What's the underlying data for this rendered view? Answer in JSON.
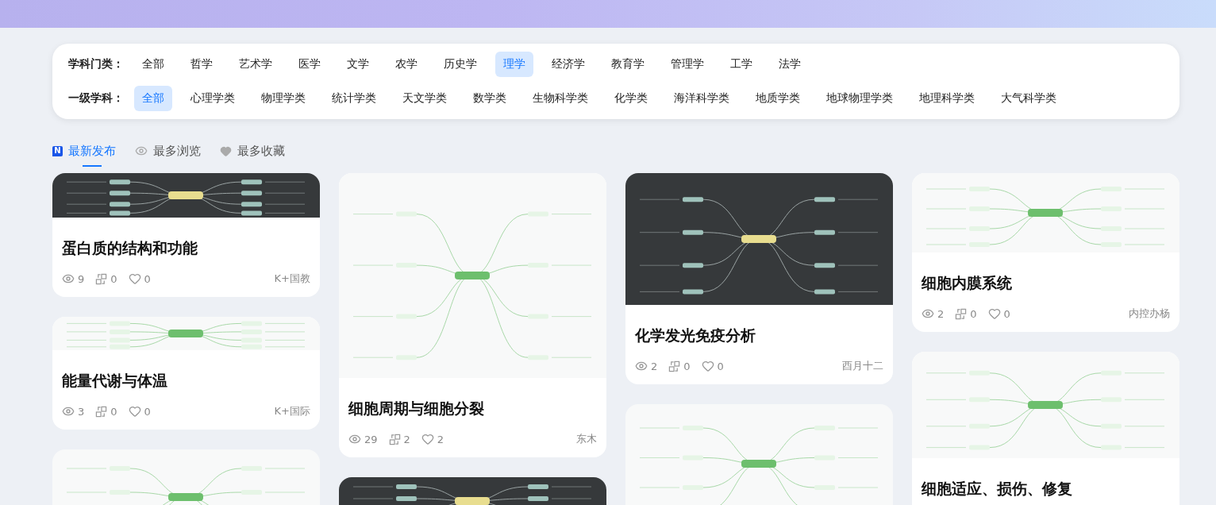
{
  "filters": [
    {
      "label": "学科门类：",
      "options": [
        {
          "label": "全部",
          "selected": false
        },
        {
          "label": "哲学",
          "selected": false
        },
        {
          "label": "艺术学",
          "selected": false
        },
        {
          "label": "医学",
          "selected": false
        },
        {
          "label": "文学",
          "selected": false
        },
        {
          "label": "农学",
          "selected": false
        },
        {
          "label": "历史学",
          "selected": false
        },
        {
          "label": "理学",
          "selected": true
        },
        {
          "label": "经济学",
          "selected": false
        },
        {
          "label": "教育学",
          "selected": false
        },
        {
          "label": "管理学",
          "selected": false
        },
        {
          "label": "工学",
          "selected": false
        },
        {
          "label": "法学",
          "selected": false
        }
      ]
    },
    {
      "label": "一级学科：",
      "options": [
        {
          "label": "全部",
          "selected": true
        },
        {
          "label": "心理学类",
          "selected": false
        },
        {
          "label": "物理学类",
          "selected": false
        },
        {
          "label": "统计学类",
          "selected": false
        },
        {
          "label": "天文学类",
          "selected": false
        },
        {
          "label": "数学类",
          "selected": false
        },
        {
          "label": "生物科学类",
          "selected": false
        },
        {
          "label": "化学类",
          "selected": false
        },
        {
          "label": "海洋科学类",
          "selected": false
        },
        {
          "label": "地质学类",
          "selected": false
        },
        {
          "label": "地球物理学类",
          "selected": false
        },
        {
          "label": "地理科学类",
          "selected": false
        },
        {
          "label": "大气科学类",
          "selected": false
        }
      ]
    }
  ],
  "sort_tabs": [
    {
      "kind": "new",
      "badge": "N",
      "label": "最新发布",
      "selected": true
    },
    {
      "kind": "views",
      "label": "最多浏览",
      "selected": false
    },
    {
      "kind": "favorites",
      "label": "最多收藏",
      "selected": false
    }
  ],
  "columns": [
    {
      "cards": [
        {
          "kind": "dark",
          "title": "蛋白质的结构和功能",
          "views": "9",
          "shares": "0",
          "likes": "0",
          "author": "K+国教"
        },
        {
          "kind": "light",
          "title": "能量代谢与体温",
          "views": "3",
          "shares": "0",
          "likes": "0",
          "author": "K+国际"
        },
        {
          "kind": "light"
        }
      ]
    },
    {
      "cards": [
        {
          "kind": "light",
          "title": "细胞周期与细胞分裂",
          "views": "29",
          "shares": "2",
          "likes": "2",
          "author": "东木"
        },
        {
          "kind": "dark"
        }
      ]
    },
    {
      "cards": [
        {
          "kind": "dark",
          "title": "化学发光免疫分析",
          "views": "2",
          "shares": "0",
          "likes": "0",
          "author": "酉月十二"
        },
        {
          "kind": "light"
        }
      ]
    },
    {
      "cards": [
        {
          "kind": "light",
          "title": "细胞内膜系统",
          "views": "2",
          "shares": "0",
          "likes": "0",
          "author": "内控办杨"
        },
        {
          "kind": "light",
          "title": "细胞适应、损伤、修复"
        }
      ]
    }
  ]
}
